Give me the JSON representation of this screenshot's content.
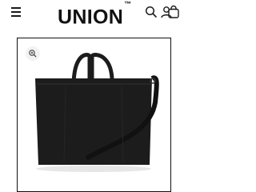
{
  "header": {
    "brand": "UNION",
    "trademark": "™",
    "menu_icon": "hamburger-menu-icon",
    "search_icon": "search-icon",
    "account_icon": "user-icon",
    "cart_icon": "shopping-bag-icon"
  },
  "product": {
    "zoom_icon": "zoom-in-icon",
    "image_subject": "black-tote-bag",
    "colors": {
      "bag": "#1c1c1c",
      "frame": "#111111"
    }
  }
}
